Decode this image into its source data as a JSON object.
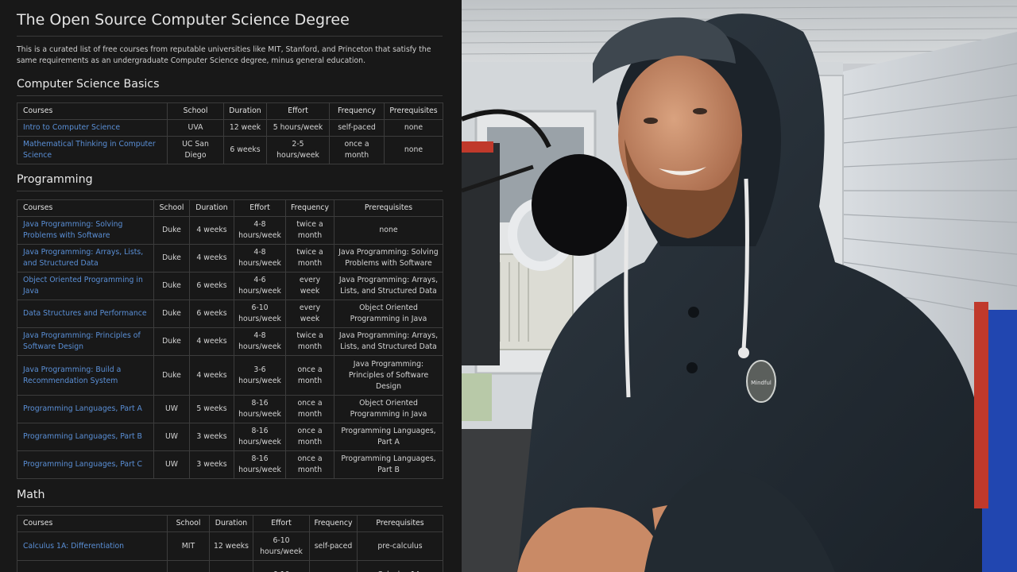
{
  "doc": {
    "title": "The Open Source Computer Science Degree",
    "intro": "This is a curated list of free courses from reputable universities like MIT, Stanford, and Princeton that satisfy the same requirements as an undergraduate Computer Science degree, minus general education.",
    "headers": [
      "Courses",
      "School",
      "Duration",
      "Effort",
      "Frequency",
      "Prerequisites"
    ],
    "sections": [
      {
        "heading": "Computer Science Basics",
        "rows": [
          {
            "course": "Intro to Computer Science",
            "school": "UVA",
            "duration": "12 week",
            "effort": "5 hours/week",
            "frequency": "self-paced",
            "prereq": "none"
          },
          {
            "course": "Mathematical Thinking in Computer Science",
            "school": "UC San Diego",
            "duration": "6 weeks",
            "effort": "2-5 hours/week",
            "frequency": "once a month",
            "prereq": "none"
          }
        ]
      },
      {
        "heading": "Programming",
        "rows": [
          {
            "course": "Java Programming: Solving Problems with Software",
            "school": "Duke",
            "duration": "4 weeks",
            "effort": "4-8 hours/week",
            "frequency": "twice a month",
            "prereq": "none"
          },
          {
            "course": "Java Programming: Arrays, Lists, and Structured Data",
            "school": "Duke",
            "duration": "4 weeks",
            "effort": "4-8 hours/week",
            "frequency": "twice a month",
            "prereq": "Java Programming: Solving Problems with Software"
          },
          {
            "course": "Object Oriented Programming in Java",
            "school": "Duke",
            "duration": "6 weeks",
            "effort": "4-6 hours/week",
            "frequency": "every week",
            "prereq": "Java Programming: Arrays, Lists, and Structured Data"
          },
          {
            "course": "Data Structures and Performance",
            "school": "Duke",
            "duration": "6 weeks",
            "effort": "6-10 hours/week",
            "frequency": "every week",
            "prereq": "Object Oriented Programming in Java"
          },
          {
            "course": "Java Programming: Principles of Software Design",
            "school": "Duke",
            "duration": "4 weeks",
            "effort": "4-8 hours/week",
            "frequency": "twice a month",
            "prereq": "Java Programming: Arrays, Lists, and Structured Data"
          },
          {
            "course": "Java Programming: Build a Recommendation System",
            "school": "Duke",
            "duration": "4 weeks",
            "effort": "3-6 hours/week",
            "frequency": "once a month",
            "prereq": "Java Programming: Principles of Software Design"
          },
          {
            "course": "Programming Languages, Part A",
            "school": "UW",
            "duration": "5 weeks",
            "effort": "8-16 hours/week",
            "frequency": "once a month",
            "prereq": "Object Oriented Programming in Java"
          },
          {
            "course": "Programming Languages, Part B",
            "school": "UW",
            "duration": "3 weeks",
            "effort": "8-16 hours/week",
            "frequency": "once a month",
            "prereq": "Programming Languages, Part A"
          },
          {
            "course": "Programming Languages, Part C",
            "school": "UW",
            "duration": "3 weeks",
            "effort": "8-16 hours/week",
            "frequency": "once a month",
            "prereq": "Programming Languages, Part B"
          }
        ]
      },
      {
        "heading": "Math",
        "rows": [
          {
            "course": "Calculus 1A: Differentiation",
            "school": "MIT",
            "duration": "12 weeks",
            "effort": "6-10 hours/week",
            "frequency": "self-paced",
            "prereq": "pre-calculus"
          },
          {
            "course": "",
            "school": "",
            "duration": "",
            "effort": "6-10",
            "frequency": "",
            "prereq": "Calculus 1A:"
          }
        ]
      }
    ]
  },
  "video": {
    "patch_text": "Mindful"
  }
}
